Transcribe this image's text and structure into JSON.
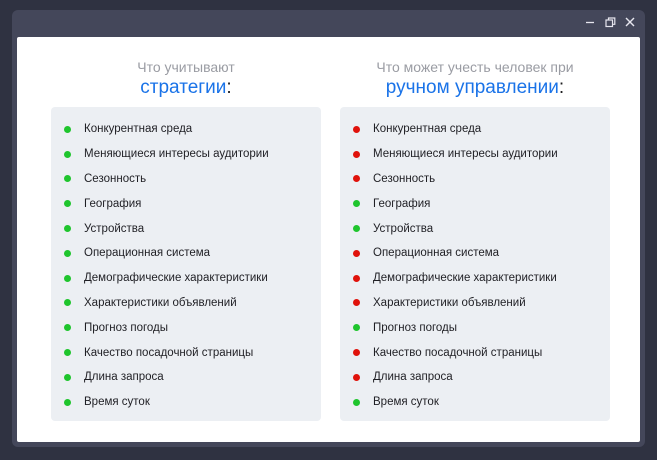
{
  "colors": {
    "accent": "#1a73e8",
    "good": "#1fc52d",
    "bad": "#e0120b"
  },
  "window": {
    "controls": [
      "minimize-icon",
      "restore-icon",
      "close-icon"
    ]
  },
  "left": {
    "heading_line1": "Что учитывают",
    "heading_line2": "стратегии",
    "colon": ":",
    "items": [
      {
        "label": "Конкурентная среда",
        "status": "green"
      },
      {
        "label": "Меняющиеся интересы аудитории",
        "status": "green"
      },
      {
        "label": "Сезонность",
        "status": "green"
      },
      {
        "label": "География",
        "status": "green"
      },
      {
        "label": "Устройства",
        "status": "green"
      },
      {
        "label": "Операционная система",
        "status": "green"
      },
      {
        "label": "Демографические характеристики",
        "status": "green"
      },
      {
        "label": "Характеристики объявлений",
        "status": "green"
      },
      {
        "label": "Прогноз погоды",
        "status": "green"
      },
      {
        "label": "Качество посадочной страницы",
        "status": "green"
      },
      {
        "label": "Длина запроса",
        "status": "green"
      },
      {
        "label": "Время суток",
        "status": "green"
      }
    ]
  },
  "right": {
    "heading_line1": "Что может учесть человек при",
    "heading_line2": "ручном управлении",
    "colon": ":",
    "items": [
      {
        "label": "Конкурентная среда",
        "status": "red"
      },
      {
        "label": "Меняющиеся интересы аудитории",
        "status": "red"
      },
      {
        "label": "Сезонность",
        "status": "red"
      },
      {
        "label": "География",
        "status": "green"
      },
      {
        "label": "Устройства",
        "status": "green"
      },
      {
        "label": "Операционная система",
        "status": "red"
      },
      {
        "label": "Демографические характеристики",
        "status": "red"
      },
      {
        "label": "Характеристики объявлений",
        "status": "red"
      },
      {
        "label": "Прогноз погоды",
        "status": "green"
      },
      {
        "label": "Качество посадочной страницы",
        "status": "red"
      },
      {
        "label": "Длина запроса",
        "status": "red"
      },
      {
        "label": "Время суток",
        "status": "green"
      }
    ]
  }
}
